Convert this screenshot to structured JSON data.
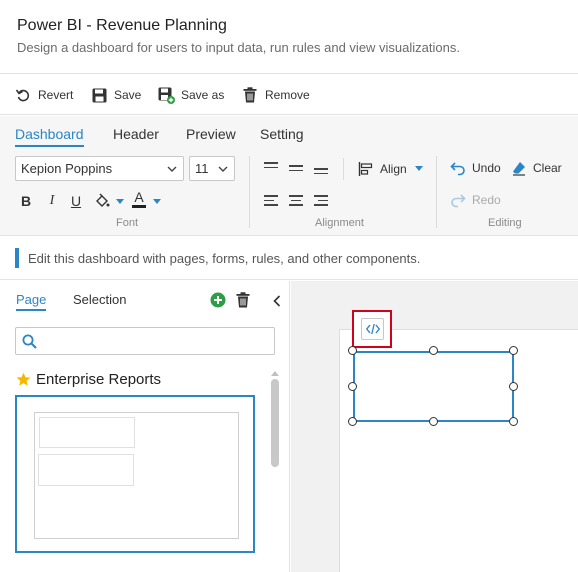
{
  "app": {
    "title": "Power BI - Revenue Planning",
    "subtitle": "Design a dashboard for users to input data, run rules and view visualizations."
  },
  "toolbar": {
    "revert_label": "Revert",
    "save_label": "Save",
    "save_as_label": "Save as",
    "remove_label": "Remove"
  },
  "ribbon": {
    "tabs": [
      "Dashboard",
      "Header",
      "Preview",
      "Setting"
    ],
    "active_tab": "Dashboard",
    "font": {
      "family_value": "Kepion Poppins",
      "size_value": "11",
      "bold": "B",
      "italic": "I",
      "underline": "U",
      "color_letter": "A",
      "group_label": "Font"
    },
    "alignment": {
      "align_label": "Align",
      "group_label": "Alignment"
    },
    "editing": {
      "undo_label": "Undo",
      "clear_label": "Clear",
      "redo_label": "Redo",
      "group_label": "Editing"
    }
  },
  "info": {
    "message": "Edit this dashboard with pages, forms, rules, and other components."
  },
  "left_panel": {
    "tabs": [
      "Page",
      "Selection"
    ],
    "active_tab": "Page",
    "search_value": "",
    "page_name": "Enterprise Reports"
  },
  "colors": {
    "accent": "#2a86c4",
    "highlight": "#d0021b",
    "add_green": "#2e9e44",
    "star": "#f5b800"
  },
  "icons": {
    "revert": "revert-icon",
    "save": "save-icon",
    "save_as": "save-as-icon",
    "remove": "trash-icon",
    "undo": "undo-icon",
    "clear": "eraser-icon",
    "redo": "redo-icon",
    "fill_color": "paint-bucket-icon",
    "add_page": "plus-circle-icon",
    "delete_page": "trash-icon",
    "collapse": "chevron-left-icon",
    "search": "search-icon",
    "favorite": "star-icon",
    "code": "code-icon"
  }
}
